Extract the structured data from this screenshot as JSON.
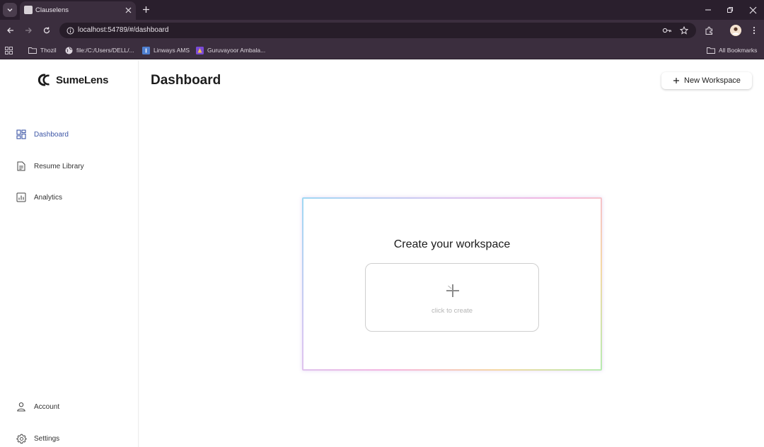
{
  "browser": {
    "tab_title": "Clauselens",
    "url": "localhost:54789/#/dashboard",
    "bookmarks": [
      {
        "label": "Thozil",
        "icon": "folder-icon"
      },
      {
        "label": "file:/C:/Users/DELL/...",
        "icon": "globe-icon"
      },
      {
        "label": "Linways AMS",
        "icon": "linways-icon"
      },
      {
        "label": "Guruvayoor Ambala...",
        "icon": "temple-icon"
      }
    ],
    "all_bookmarks": "All Bookmarks"
  },
  "app": {
    "logo_text": "SumeLens",
    "page_title": "Dashboard",
    "new_workspace_label": "New Workspace",
    "nav": [
      {
        "label": "Dashboard",
        "icon": "dashboard-icon",
        "active": true
      },
      {
        "label": "Resume Library",
        "icon": "document-icon",
        "active": false
      },
      {
        "label": "Analytics",
        "icon": "analytics-icon",
        "active": false
      }
    ],
    "bottom_nav": [
      {
        "label": "Account",
        "icon": "user-icon"
      },
      {
        "label": "Settings",
        "icon": "settings-icon"
      }
    ],
    "workspace_card": {
      "title": "Create your workspace",
      "create_label": "click to create"
    }
  },
  "colors": {
    "accent": "#3d56a6",
    "chrome_dark": "#2a1f2d",
    "chrome": "#3b2e3e"
  }
}
